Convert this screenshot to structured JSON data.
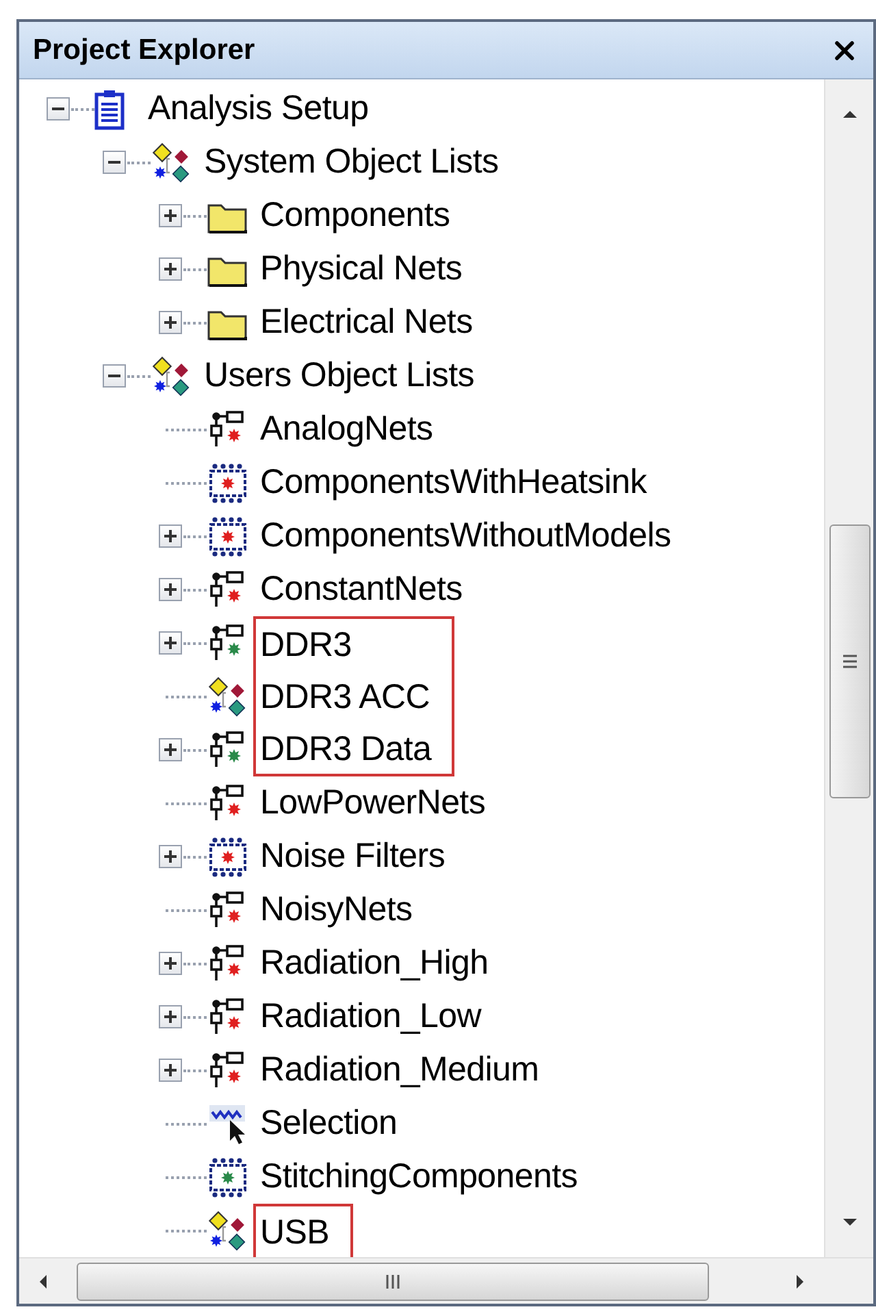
{
  "panel": {
    "title": "Project Explorer"
  },
  "tree": [
    {
      "label": "Analysis Setup",
      "kind": "clipboard",
      "expanded": true,
      "children": [
        {
          "label": "System Object Lists",
          "kind": "object-list",
          "expanded": true,
          "children": [
            {
              "label": "Components",
              "kind": "folder",
              "expanded": false
            },
            {
              "label": "Physical Nets",
              "kind": "folder",
              "expanded": false
            },
            {
              "label": "Electrical Nets",
              "kind": "folder",
              "expanded": false
            }
          ]
        },
        {
          "label": "Users Object Lists",
          "kind": "object-list",
          "expanded": true,
          "children": [
            {
              "label": "AnalogNets",
              "kind": "net",
              "color": "#e02020"
            },
            {
              "label": "ComponentsWithHeatsink",
              "kind": "component",
              "color": "#e02020"
            },
            {
              "label": "ComponentsWithoutModels",
              "kind": "component",
              "color": "#e02020",
              "expanded": false
            },
            {
              "label": "ConstantNets",
              "kind": "net",
              "color": "#e02020",
              "expanded": false
            },
            {
              "label": "DDR3",
              "kind": "net",
              "color": "#2a8a4a",
              "expanded": false,
              "highlighted": true
            },
            {
              "label": "DDR3 ACC",
              "kind": "object-list",
              "highlighted": true
            },
            {
              "label": "DDR3 Data",
              "kind": "net",
              "color": "#2a8a4a",
              "expanded": false,
              "highlighted": true
            },
            {
              "label": "LowPowerNets",
              "kind": "net",
              "color": "#e02020"
            },
            {
              "label": "Noise Filters",
              "kind": "component",
              "color": "#e02020",
              "expanded": false
            },
            {
              "label": "NoisyNets",
              "kind": "net",
              "color": "#e02020"
            },
            {
              "label": "Radiation_High",
              "kind": "net",
              "color": "#e02020",
              "expanded": false
            },
            {
              "label": "Radiation_Low",
              "kind": "net",
              "color": "#e02020",
              "expanded": false
            },
            {
              "label": "Radiation_Medium",
              "kind": "net",
              "color": "#e02020",
              "expanded": false
            },
            {
              "label": "Selection",
              "kind": "selection"
            },
            {
              "label": "StitchingComponents",
              "kind": "component",
              "color": "#2a8a4a"
            },
            {
              "label": "USB",
              "kind": "object-list",
              "highlighted": true
            }
          ]
        }
      ]
    }
  ]
}
